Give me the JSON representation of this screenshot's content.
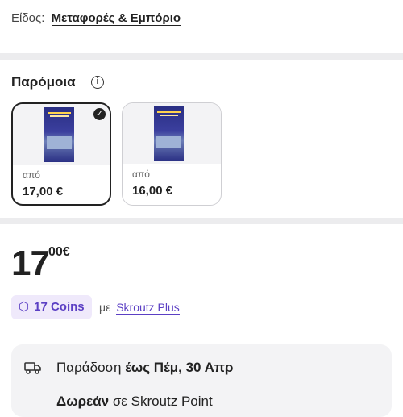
{
  "type_row": {
    "label": "Είδος:",
    "value": "Μεταφορές & Εμπόριο"
  },
  "similar": {
    "title": "Παρόμοια",
    "info_icon": "info-icon",
    "cards": [
      {
        "apo": "από",
        "price": "17,00 €",
        "selected": true
      },
      {
        "apo": "από",
        "price": "16,00 €",
        "selected": false
      }
    ]
  },
  "price": {
    "whole": "17",
    "fraction": "00€"
  },
  "coins": {
    "label": "17 Coins",
    "icon": "coin-icon",
    "suffix": "με",
    "plus_link": "Skroutz Plus"
  },
  "delivery": {
    "icon": "truck-icon",
    "prefix": "Παράδοση",
    "date": "έως Πέμ, 30 Απρ",
    "free_bold": "Δωρεάν",
    "free_rest": "σε Skroutz Point"
  },
  "colors": {
    "accent": "#5b3fc4",
    "pill_bg": "#efe9fb",
    "separator": "#ececee"
  }
}
